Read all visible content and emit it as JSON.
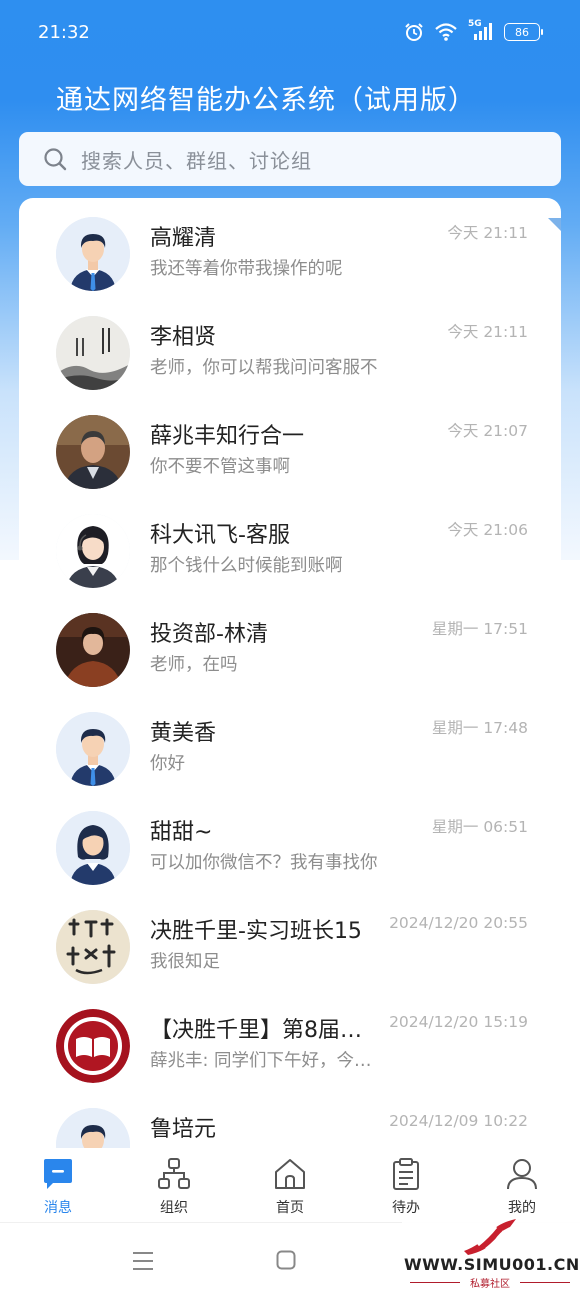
{
  "status_bar": {
    "time": "21:32",
    "network": "5G",
    "battery": "86"
  },
  "app_title": "通达网络智能办公系统（试用版）",
  "search": {
    "placeholder": "搜索人员、群组、讨论组"
  },
  "messages": [
    {
      "name": "高耀清",
      "preview": "我还等着你带我操作的呢",
      "time": "今天 21:11",
      "avatar": "default-male-avatar"
    },
    {
      "name": "李相贤",
      "preview": "老师，你可以帮我问问客服不",
      "time": "今天 21:11",
      "avatar": "calligraphy-avatar"
    },
    {
      "name": "薛兆丰知行合一",
      "preview": "你不要不管这事啊",
      "time": "今天 21:07",
      "avatar": "photo-man-avatar"
    },
    {
      "name": "科大讯飞-客服",
      "preview": "那个钱什么时候能到账啊",
      "time": "今天 21:06",
      "avatar": "service-woman-avatar"
    },
    {
      "name": "投资部-林清",
      "preview": "老师，在吗",
      "time": "星期一 17:51",
      "avatar": "photo-woman-avatar"
    },
    {
      "name": "黄美香",
      "preview": "你好",
      "time": "星期一 17:48",
      "avatar": "default-male-avatar"
    },
    {
      "name": "甜甜~",
      "preview": "可以加你微信不？我有事找你",
      "time": "星期一 06:51",
      "avatar": "default-female-avatar"
    },
    {
      "name": "决胜千里-实习班长15",
      "preview": "我很知足",
      "time": "2024/12/20 20:55",
      "avatar": "calligraphy-avatar"
    },
    {
      "name": "【决胜千里】第8届…",
      "preview": "薛兆丰: 同学们下午好，今…",
      "time": "2024/12/20 15:19",
      "avatar": "book-emblem-avatar"
    },
    {
      "name": "鲁培元",
      "preview": "",
      "time": "2024/12/09 10:22",
      "avatar": "default-male-avatar"
    }
  ],
  "tabs": [
    {
      "label": "消息",
      "icon": "message-icon",
      "active": true
    },
    {
      "label": "组织",
      "icon": "org-chart-icon",
      "active": false
    },
    {
      "label": "首页",
      "icon": "home-icon",
      "active": false
    },
    {
      "label": "待办",
      "icon": "clipboard-icon",
      "active": false
    },
    {
      "label": "我的",
      "icon": "user-icon",
      "active": false
    }
  ],
  "watermark": {
    "url": "WWW.SIMU001.CN",
    "subtitle": "私募社区"
  },
  "colors": {
    "primary": "#2a86ec",
    "text": "#222222",
    "muted": "#8d8d8d",
    "time": "#b4b4b4"
  }
}
